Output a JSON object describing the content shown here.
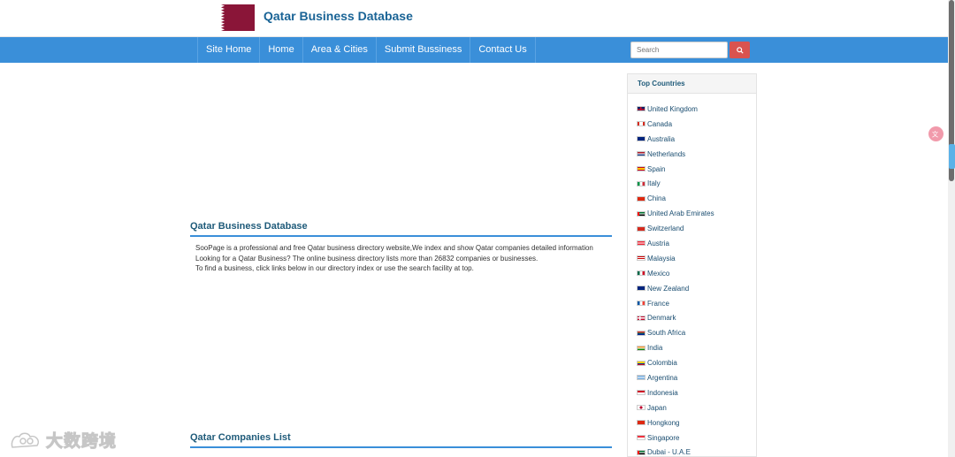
{
  "header": {
    "title": "Qatar Business Database"
  },
  "nav": [
    {
      "label": "Site Home"
    },
    {
      "label": "Home"
    },
    {
      "label": "Area & Cities"
    },
    {
      "label": "Submit Bussiness"
    },
    {
      "label": "Contact Us"
    }
  ],
  "search": {
    "placeholder": "Search"
  },
  "main": {
    "heading": "Qatar Business Database",
    "paragraphs": [
      "SooPage is a professional and free Qatar business directory website,We index and show Qatar companies detailed information",
      "Looking for a Qatar Business? The online business directory lists more than 26832 companies or businesses.",
      "To find a business, click links below in our directory index or use the search facility at top."
    ],
    "companies_heading": "Qatar Companies List"
  },
  "sidebar": {
    "title": "Top Countries",
    "countries": [
      "United Kingdom",
      "Canada",
      "Australia",
      "Netherlands",
      "Spain",
      "Italy",
      "China",
      "United Arab Emirates",
      "Switzerland",
      "Austria",
      "Malaysia",
      "Mexico",
      "New Zealand",
      "France",
      "Denmark",
      "South Africa",
      "India",
      "Colombia",
      "Argentina",
      "Indonesia",
      "Japan",
      "Hongkong",
      "Singapore",
      "Dubai - U.A.E"
    ]
  },
  "colors": {
    "nav": "#3a8fd9",
    "title": "#1a6496",
    "qatar_maroon": "#8a1538",
    "search_button": "#d9534f"
  },
  "icons": {
    "search": "search-icon",
    "translate": "translate-icon"
  },
  "watermark": {
    "text": "大数跨境"
  }
}
